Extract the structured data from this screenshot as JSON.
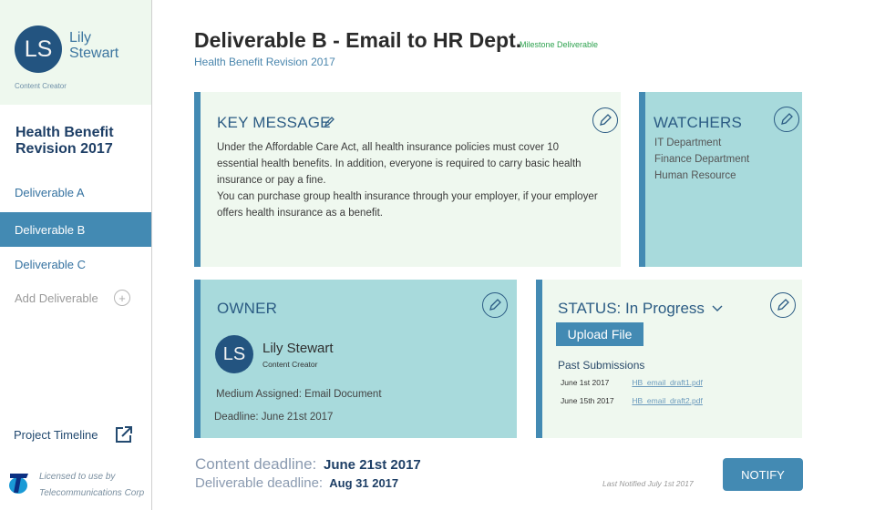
{
  "user": {
    "initials": "LS",
    "name": "Lily Stewart",
    "role": "Content Creator"
  },
  "sidebar": {
    "project_title": "Health Benefit Revision 2017",
    "items": [
      {
        "label": "Deliverable A",
        "active": false
      },
      {
        "label": "Deliverable B",
        "active": true
      },
      {
        "label": "Deliverable C",
        "active": false
      }
    ],
    "add_label": "Add Deliverable",
    "add_icon": "plus-circle-icon",
    "timeline_label": "Project Timeline",
    "timeline_icon": "external-link-icon",
    "license_line1": "Licensed to use by",
    "license_line2": "Telecommunications Corp"
  },
  "header": {
    "title": "Deliverable B - Email to HR Dept.",
    "badge": "Milestone Deliverable",
    "subtitle": "Health Benefit Revision 2017"
  },
  "key_message": {
    "title": "KEY MESSAGE",
    "paragraph1": "Under the Affordable Care Act, all health insurance policies must cover 10 essential health benefits. In addition, everyone is required to carry basic health insurance or pay a fine.",
    "paragraph2": "You can purchase group health insurance through your employer, if your employer offers health insurance as a benefit."
  },
  "watchers": {
    "title": "WATCHERS",
    "items": [
      "IT Department",
      "Finance Department",
      "Human Resource"
    ]
  },
  "owner": {
    "title": "OWNER",
    "initials": "LS",
    "name": "Lily Stewart",
    "role": "Content Creator",
    "medium": "Medium Assigned:  Email Document",
    "deadline": "Deadline: June 21st 2017"
  },
  "status": {
    "label": "STATUS:",
    "value": "In Progress",
    "upload_label": "Upload File",
    "past_title": "Past Submissions",
    "submissions": [
      {
        "date": "June 1st 2017",
        "file": "HB_email_draft1.pdf"
      },
      {
        "date": "June 15th 2017",
        "file": "HB_email_draft2.pdf"
      }
    ]
  },
  "footer": {
    "content_deadline_label": "Content deadline:",
    "content_deadline": "June 21st 2017",
    "deliverable_deadline_label": "Deliverable deadline:",
    "deliverable_deadline": "Aug 31 2017",
    "last_notified": "Last Notified July 1st 2017",
    "notify_label": "NOTIFY"
  },
  "colors": {
    "accent": "#438ab3",
    "navy": "#235480",
    "teal_card": "#a8dadc",
    "light_card": "#eff8ef",
    "milestone_green": "#2ea24f"
  }
}
